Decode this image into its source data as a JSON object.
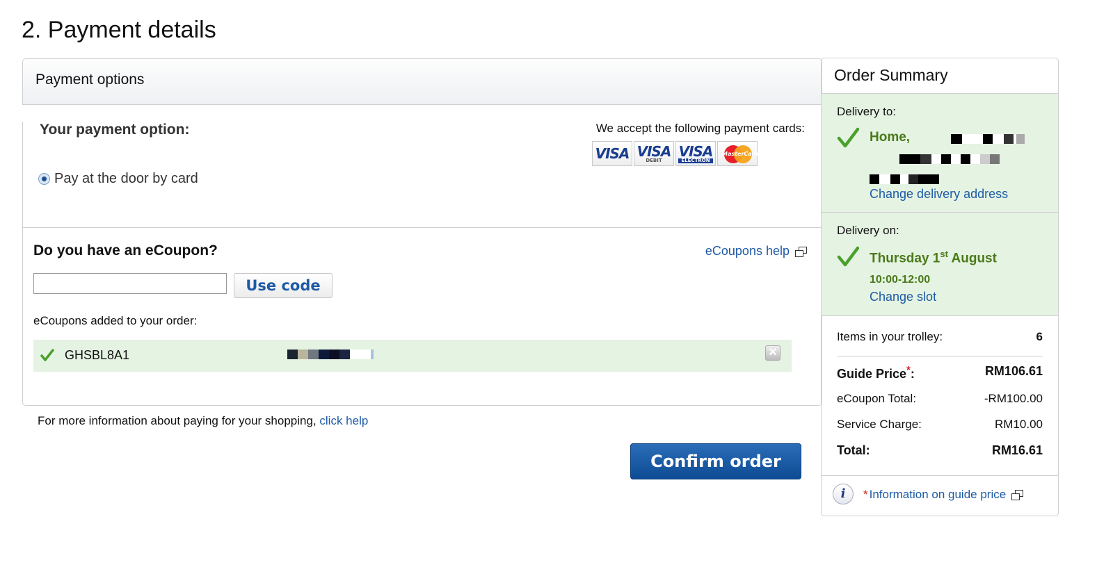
{
  "page": {
    "title": "2. Payment details"
  },
  "payment_options": {
    "header": "Payment options",
    "your_option_label": "Your payment option:",
    "radio_option": "Pay at the door by card",
    "accept_text": "We accept the following payment cards:",
    "cards": [
      {
        "name": "VISA",
        "sub": ""
      },
      {
        "name": "VISA",
        "sub": "DEBIT"
      },
      {
        "name": "VISA",
        "sub": "ELECTRON"
      },
      {
        "name": "MasterCard",
        "sub": ""
      }
    ]
  },
  "ecoupon": {
    "title": "Do you have an eCoupon?",
    "help_link": "eCoupons help",
    "input_value": "",
    "use_code_label": "Use code",
    "added_label": "eCoupons added to your order:",
    "applied_code": "GHSBL8A1",
    "applied_color": "#e5f3e2"
  },
  "footer": {
    "info_text": "For more information about paying for your shopping,",
    "info_link": "click help",
    "confirm_label": "Confirm order"
  },
  "summary": {
    "title": "Order Summary",
    "delivery_to_label": "Delivery to:",
    "address_name": "Home,",
    "change_address": "Change delivery address",
    "delivery_on_label": "Delivery on:",
    "date_day": "Thursday 1",
    "date_sup": "st",
    "date_month": " August",
    "time_slot": "10:00-12:00",
    "change_slot": "Change slot",
    "items_label": "Items in your trolley:",
    "items_count": "6",
    "guide_price_label": "Guide Price",
    "guide_price_star": "*",
    "guide_price_colon": ":",
    "guide_price_value": "RM106.61",
    "ecoupon_total_label": "eCoupon Total:",
    "ecoupon_total_value": "-RM100.00",
    "service_charge_label": "Service Charge:",
    "service_charge_value": "RM10.00",
    "total_label": "Total:",
    "total_value": "RM16.61",
    "guide_info_star": "*",
    "guide_info_link": "Information on guide price"
  },
  "colors": {
    "link_blue": "#1d5aa6",
    "success_green": "#4a7a1a",
    "confirm_blue": "#0d4b94",
    "highlight_green": "#e5f3e2"
  }
}
